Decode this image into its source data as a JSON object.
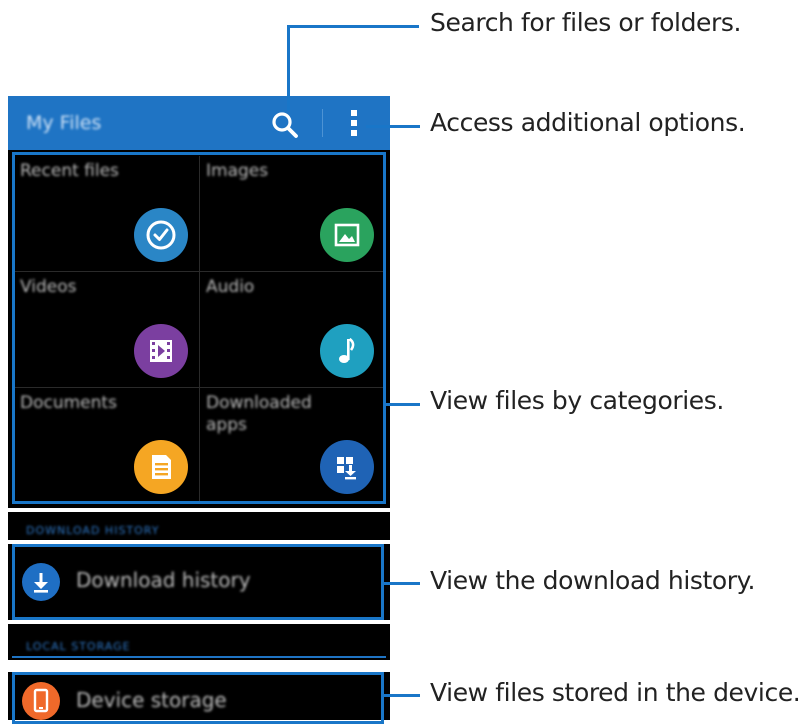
{
  "app": {
    "title": "My Files"
  },
  "categories": [
    {
      "label": "Recent files",
      "icon": "clock-icon",
      "color": "#2a86c6"
    },
    {
      "label": "Images",
      "icon": "image-icon",
      "color": "#2aa35e"
    },
    {
      "label": "Videos",
      "icon": "video-icon",
      "color": "#7b3fa0"
    },
    {
      "label": "Audio",
      "icon": "music-note-icon",
      "color": "#1fa0c0"
    },
    {
      "label": "Documents",
      "icon": "document-icon",
      "color": "#f5a623"
    },
    {
      "label": "Downloaded apps",
      "icon": "download-apps-icon",
      "color": "#1f63b5"
    }
  ],
  "sections": {
    "download_history_header": "DOWNLOAD HISTORY",
    "local_storage_header": "LOCAL STORAGE"
  },
  "rows": {
    "download_history": {
      "label": "Download history",
      "icon": "download-icon",
      "color": "#1f6fc4"
    },
    "device_storage": {
      "label": "Device storage",
      "icon": "phone-icon",
      "color": "#f0692a"
    }
  },
  "callouts": {
    "search": "Search for files or folders.",
    "options": "Access additional options.",
    "categories": "View files by categories.",
    "download_history": "View the download history.",
    "device_storage": "View files stored in the device."
  },
  "colors": {
    "appbar": "#1f74c4",
    "callout": "#1976c8"
  }
}
